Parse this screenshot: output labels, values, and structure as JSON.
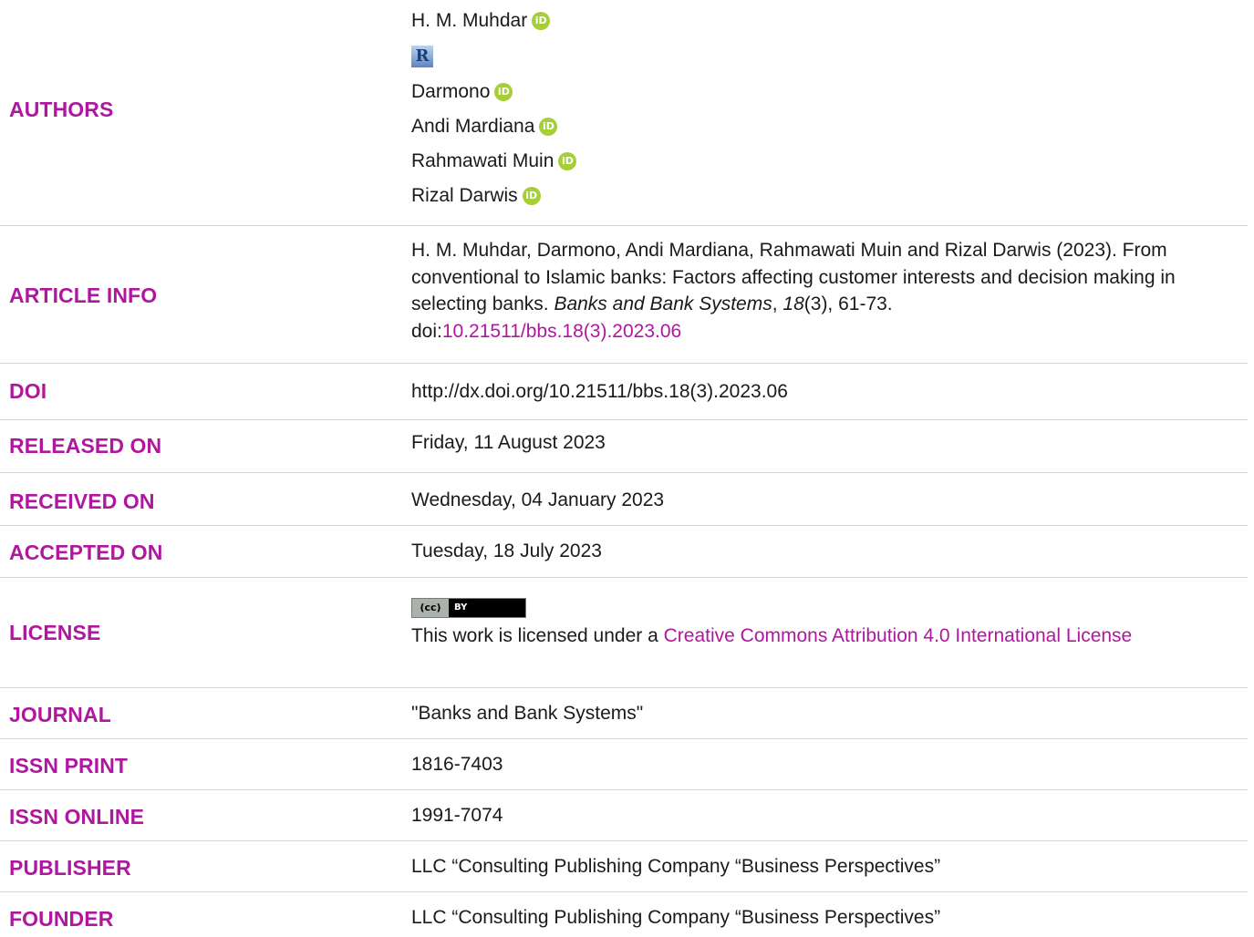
{
  "rows": {
    "authors": {
      "label": "AUTHORS",
      "names": [
        "H. M. Muhdar",
        "Darmono",
        "Andi Mardiana",
        "Rahmawati Muin",
        "Rizal Darwis"
      ],
      "orcid_icon": "iD",
      "researcherid_icon": "R"
    },
    "article_info": {
      "label": "ARTICLE INFO",
      "citation_prefix": "H. M. Muhdar, Darmono, Andi Mardiana, Rahmawati Muin and Rizal Darwis (2023). From conventional to Islamic banks: Factors affecting customer interests and decision making in selecting banks. ",
      "journal_italic": "Banks and Bank Systems",
      "comma1": ", ",
      "volume_italic": "18",
      "issue_pages": "(3), 61-73.",
      "doi_prefix": "doi:",
      "doi_link": "10.21511/bbs.18(3).2023.06"
    },
    "doi": {
      "label": "DOI",
      "value": "http://dx.doi.org/10.21511/bbs.18(3).2023.06"
    },
    "released": {
      "label": "RELEASED ON",
      "value": "Friday, 11 August 2023"
    },
    "received": {
      "label": "RECEIVED ON",
      "value": "Wednesday, 04 January 2023"
    },
    "accepted": {
      "label": "ACCEPTED ON",
      "value": "Tuesday, 18 July 2023"
    },
    "license": {
      "label": "LICENSE",
      "badge_left": "(cc)",
      "badge_right": "BY",
      "text_prefix": "This work is licensed under a ",
      "link_text": "Creative Commons Attribution 4.0 International License"
    },
    "journal": {
      "label": "JOURNAL",
      "value": "\"Banks and Bank Systems\""
    },
    "issn_print": {
      "label": "ISSN PRINT",
      "value": "1816-7403"
    },
    "issn_online": {
      "label": "ISSN ONLINE",
      "value": "1991-7074"
    },
    "publisher": {
      "label": "PUBLISHER",
      "value": "LLC “Consulting Publishing Company “Business Perspectives”"
    },
    "founder": {
      "label": "FOUNDER",
      "value": "LLC “Consulting Publishing Company “Business Perspectives”"
    }
  },
  "colors": {
    "label": "#b0179f",
    "link": "#b0179f",
    "orcid": "#a6ce39",
    "divider": "#d4d4d4"
  }
}
